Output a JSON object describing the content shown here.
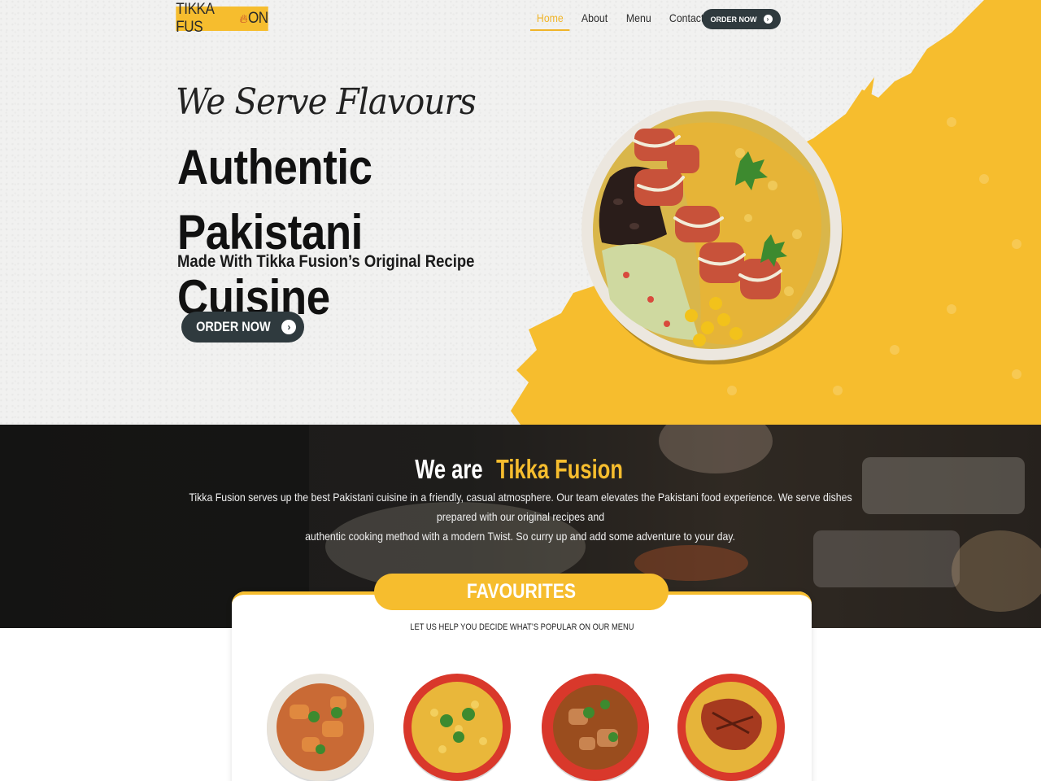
{
  "nav": {
    "logo_pre": "TIKKA FUS",
    "logo_post": "ON",
    "links": [
      "Home",
      "About",
      "Menu",
      "Contact"
    ],
    "active": "Home",
    "order_label": "ORDER NOW"
  },
  "hero": {
    "tagline": "We Serve Flavours",
    "headline_line1": "Authentic",
    "headline_line2": "Pakistani Cuisine",
    "subhead": "Made With Tikka Fusion’s Original Recipe",
    "order_label": "ORDER NOW"
  },
  "about": {
    "title_prefix": "We are ",
    "title_accent": "Tikka Fusion",
    "text_line1": "Tikka Fusion serves up the best Pakistani cuisine in a friendly, casual atmosphere. Our team elevates the Pakistani food experience. We serve dishes prepared with our original recipes and",
    "text_line2": "authentic cooking method with a modern Twist. So curry up and add some adventure to your day."
  },
  "favourites": {
    "title": "FAVOURITES",
    "subtitle": "LET US HELP YOU DECIDE WHAT’S POPULAR ON OUR MENU"
  },
  "colors": {
    "brand_yellow": "#f6bd2e",
    "dark_button": "#2f3a3e",
    "active_link": "#f0b429"
  },
  "icons": {
    "logo_flame": "flame-icon",
    "order_arrow": "chevron-circle-right-icon"
  }
}
